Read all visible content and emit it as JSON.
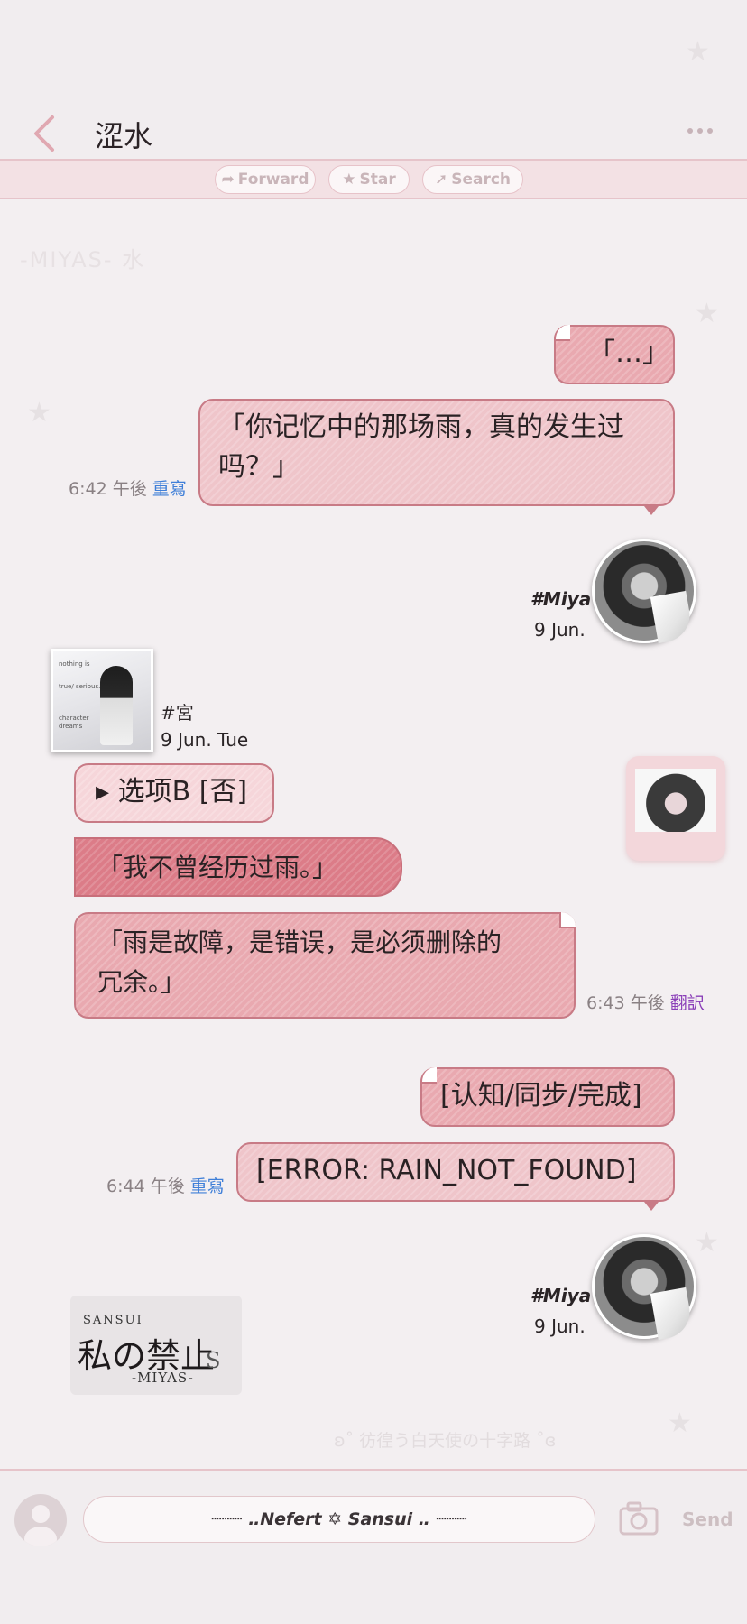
{
  "header": {
    "title": "涩水"
  },
  "toolbar": {
    "forward": "Forward",
    "star": "Star",
    "search": "Search"
  },
  "watermark_top": "-MIYAS-   水",
  "messages": {
    "m1": "「…」",
    "m2_line1": "「你记忆中的那场雨，真的发生过",
    "m2_line2": "吗？」",
    "m2_time": "6:42 午後",
    "m2_action": "重寫",
    "card1_name": "#Miya",
    "card1_date": "9 Jun.",
    "card2_name": "#宮",
    "card2_date": "9 Jun. Tue",
    "photo_texts": [
      "nothing is",
      "true/ serious...",
      "character",
      "dreams"
    ],
    "option": "▸ 选项B [否]",
    "m3": "「我不曾经历过雨。」",
    "m4_line1": "「雨是故障，是错误，是必须删除的",
    "m4_line2": "冗余。」",
    "m4_time": "6:43 午後",
    "m4_action": "翻訳",
    "m5": "[认知/同步/完成]",
    "m6": "[ERROR: RAIN_NOT_FOUND]",
    "m6_time": "6:44 午後",
    "m6_action": "重寫",
    "card3_name": "#Miya",
    "card3_date": "9 Jun."
  },
  "logo": {
    "top": "SANSUI",
    "main": "私の禁止",
    "bottom": "-MIYAS-",
    "s": "S"
  },
  "footer_watermark": "ʚ˚  彷徨う白天使の十字路  ˚ɞ",
  "input": {
    "text": "┈┈┈  ‥Nefert ✡ Sansui ‥  ┈┈┈"
  },
  "send_label": "Send",
  "colors": {
    "accent": "#e9a9b0",
    "dark_bubble": "#dc7c88",
    "link_blue": "#3f7fd8",
    "link_purple": "#8a3fb8"
  }
}
